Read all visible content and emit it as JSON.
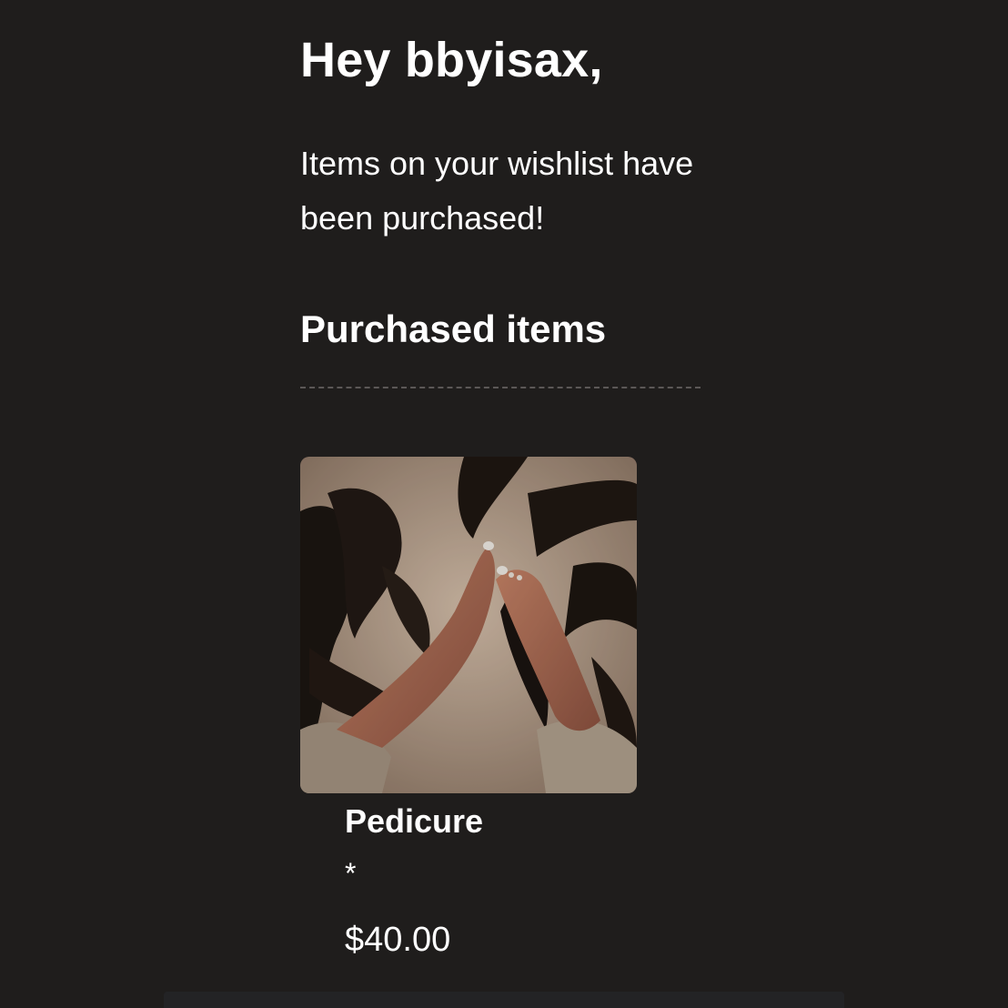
{
  "email": {
    "greeting": "Hey bbyisax,",
    "message": "Items on your wishlist have been purchased!",
    "section_title": "Purchased items"
  },
  "items": [
    {
      "name": "Pedicure",
      "note": "*",
      "price": "$40.00",
      "image": "feet-on-zebra-blanket-photo"
    }
  ],
  "colors": {
    "background": "#1f1d1c",
    "text": "#ffffff",
    "divider": "#5b5857"
  }
}
